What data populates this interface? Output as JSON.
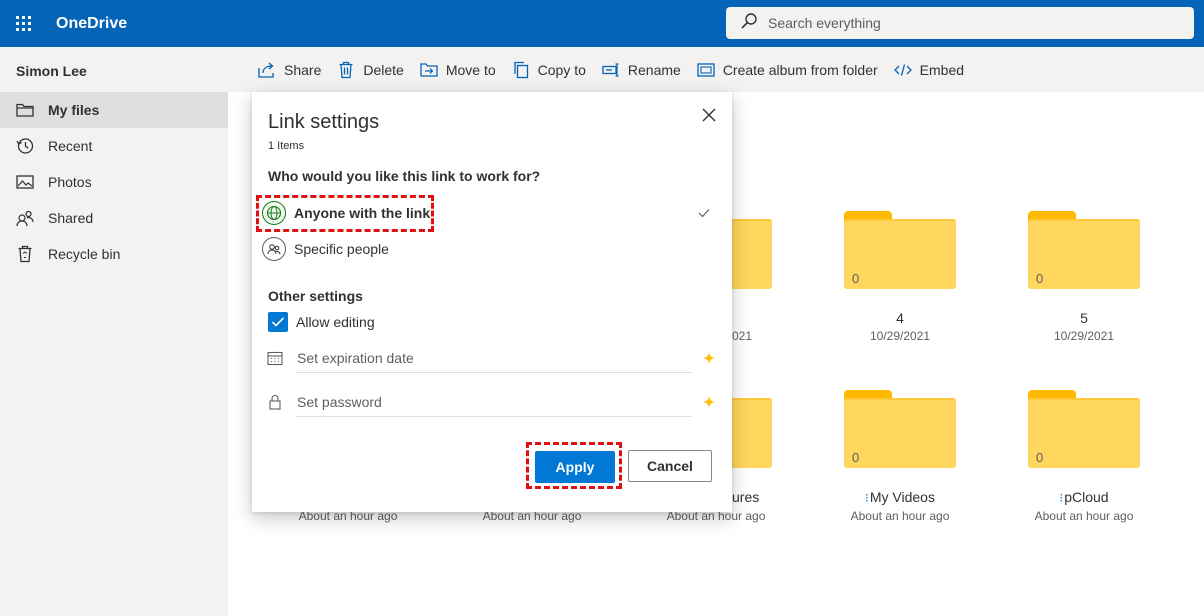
{
  "header": {
    "app_name": "OneDrive",
    "search_placeholder": "Search everything"
  },
  "sidebar": {
    "user_name": "Simon Lee",
    "items": [
      {
        "label": "My files",
        "icon": "folder-icon",
        "active": true
      },
      {
        "label": "Recent",
        "icon": "clock-icon"
      },
      {
        "label": "Photos",
        "icon": "photo-icon"
      },
      {
        "label": "Shared",
        "icon": "people-icon"
      },
      {
        "label": "Recycle bin",
        "icon": "recycle-bin-icon"
      }
    ]
  },
  "commandbar": {
    "share": "Share",
    "delete": "Delete",
    "move_to": "Move to",
    "copy_to": "Copy to",
    "rename": "Rename",
    "create_album": "Create album from folder",
    "embed": "Embed"
  },
  "files": {
    "folders": [
      {
        "name": "4",
        "date": "10/29/2021",
        "count": "0"
      },
      {
        "name": "5",
        "date": "10/29/2021",
        "count": "0"
      },
      {
        "name": "My Videos",
        "date": "About an hour ago",
        "count": "0"
      },
      {
        "name": "pCloud",
        "date": "About an hour ago",
        "count": "0"
      }
    ],
    "partial": {
      "top_date_fragment": "021",
      "bottom_name_fragment": "ures",
      "bottom_dates": [
        "About an hour ago",
        "About an hour ago",
        "About an hour ago"
      ]
    }
  },
  "dialog": {
    "title": "Link settings",
    "items_count": "1 Items",
    "question": "Who would you like this link to work for?",
    "options": [
      {
        "label": "Anyone with the link",
        "selected": true
      },
      {
        "label": "Specific people",
        "selected": false
      }
    ],
    "other_settings_title": "Other settings",
    "allow_editing_label": "Allow editing",
    "allow_editing_checked": true,
    "expiration_placeholder": "Set expiration date",
    "password_placeholder": "Set password",
    "apply_label": "Apply",
    "cancel_label": "Cancel"
  },
  "colors": {
    "topbar": "#0364b8",
    "accent": "#0078d4",
    "folder": "#ffd75e",
    "highlight": "#e01010",
    "premium_star": "#ffb900"
  }
}
